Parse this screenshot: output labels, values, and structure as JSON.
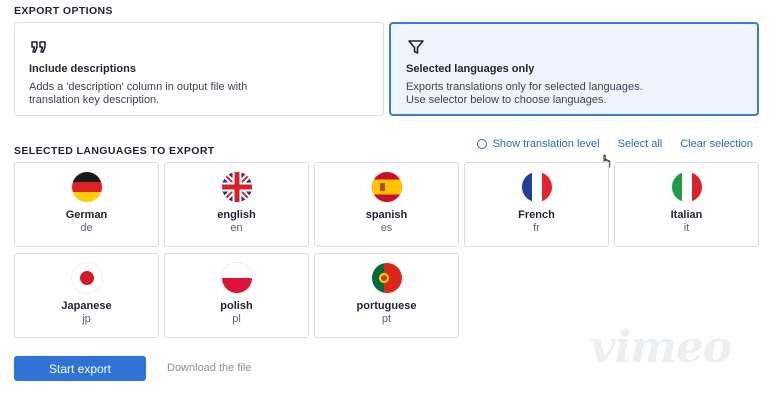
{
  "export_options": {
    "section_title": "EXPORT OPTIONS",
    "include_descriptions": {
      "icon": "quote-icon",
      "title": "Include descriptions",
      "description": "Adds a 'description' column in output file with\ntranslation key description."
    },
    "selected_languages_only": {
      "icon": "filter-icon",
      "title": "Selected languages only",
      "description": "Exports translations only for selected languages.\nUse selector below to choose languages.",
      "selected": true
    }
  },
  "languages_section": {
    "section_title": "SELECTED LANGUAGES TO EXPORT",
    "show_translation_level": "Show translation level",
    "select_all": "Select all",
    "clear_selection": "Clear selection",
    "languages": [
      {
        "name": "German",
        "code": "de",
        "flag": "flag-germany-icon"
      },
      {
        "name": "english",
        "code": "en",
        "flag": "flag-uk-icon"
      },
      {
        "name": "spanish",
        "code": "es",
        "flag": "flag-spain-icon"
      },
      {
        "name": "French",
        "code": "fr",
        "flag": "flag-france-icon"
      },
      {
        "name": "Italian",
        "code": "it",
        "flag": "flag-italy-icon"
      },
      {
        "name": "Japanese",
        "code": "jp",
        "flag": "flag-japan-icon"
      },
      {
        "name": "polish",
        "code": "pl",
        "flag": "flag-poland-icon"
      },
      {
        "name": "portuguese",
        "code": "pt",
        "flag": "flag-portugal-icon"
      }
    ]
  },
  "footer": {
    "start_export": "Start export",
    "download_file": "Download the file"
  },
  "watermark": "vimeo",
  "colors": {
    "accent": "#2f73d6",
    "link": "#2d69c2",
    "selected_border": "#3d7cc7",
    "selected_bg": "#eef4fc"
  }
}
